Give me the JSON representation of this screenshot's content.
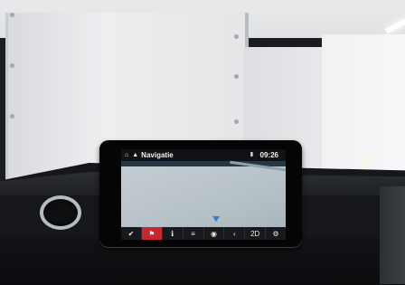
{
  "screen": {
    "status": {
      "home_icon": "home-icon",
      "nav_icon": "navigation-icon",
      "title": "Navigatie",
      "time": "09:26",
      "signal_icon": "signal-icon"
    },
    "map": {
      "position_marker_icon": "position-arrow-icon"
    },
    "toolbar": [
      {
        "icon": "check-circle-icon",
        "glyph": "✔",
        "active": false
      },
      {
        "icon": "destination-flag-icon",
        "glyph": "⚑",
        "active": true
      },
      {
        "icon": "person-info-icon",
        "glyph": "ℹ",
        "active": false
      },
      {
        "icon": "map-view-icon",
        "glyph": "≡",
        "active": false
      },
      {
        "icon": "location-pin-icon",
        "glyph": "◉",
        "active": false
      },
      {
        "icon": "back-arrow-icon",
        "glyph": "‹",
        "active": false
      },
      {
        "icon": "view-mode-label",
        "text": "2D",
        "active": false
      },
      {
        "icon": "settings-gear-icon",
        "glyph": "⚙",
        "active": false
      }
    ]
  },
  "colors": {
    "toolbar_active": "#c8262e",
    "map_background": "#b7c2c8",
    "status_text": "#f2f2f2"
  }
}
